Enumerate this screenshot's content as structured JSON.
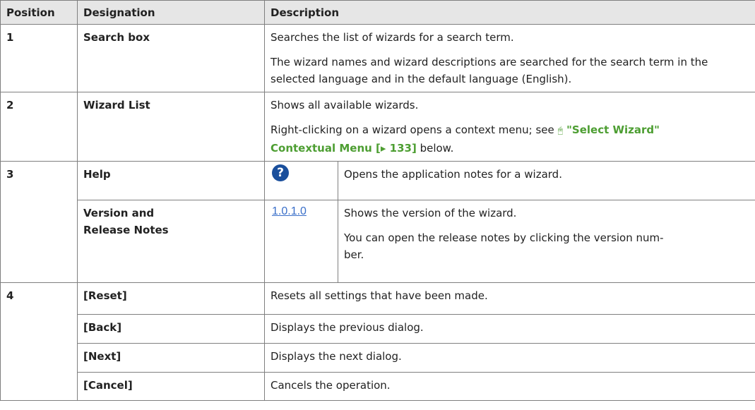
{
  "headers": {
    "position": "Position",
    "designation": "Designation",
    "description": "Description"
  },
  "rows": {
    "search": {
      "position": "1",
      "designation": "Search box",
      "desc1": "Searches the list of wizards for a search term.",
      "desc2": "The wizard names and wizard descriptions are searched for the search term in the selected language and in the default language (English)."
    },
    "wizard_list": {
      "position": "2",
      "designation": "Wizard List",
      "desc1": "Shows all available wizards.",
      "desc2_pre": "Right-clicking on a wizard opens a context menu; see ",
      "desc2_icon": "🖰",
      "desc2_link_line1": "\"Select Wizard\"",
      "desc2_link_line2": "Contextual Menu [▸ 133]",
      "desc2_post": " below."
    },
    "help": {
      "position": "3",
      "designation": "Help",
      "icon_glyph": "?",
      "icon": "help-question-icon",
      "desc": "Opens the application notes for a wizard."
    },
    "version": {
      "designation_line1": "Version and",
      "designation_line2": "Release Notes",
      "link": "1.0.1.0",
      "desc1": "Shows the version of the wizard.",
      "desc2_line1": "You can open the release notes by clicking the version num-",
      "desc2_line2": "ber."
    },
    "reset": {
      "position": "4",
      "designation": "[Reset]",
      "desc": "Resets all settings that have been made."
    },
    "back": {
      "designation": "[Back]",
      "desc": "Displays the previous dialog."
    },
    "next": {
      "designation": "[Next]",
      "desc": "Displays the next dialog."
    },
    "cancel": {
      "designation": "[Cancel]",
      "desc": "Cancels the operation."
    }
  }
}
